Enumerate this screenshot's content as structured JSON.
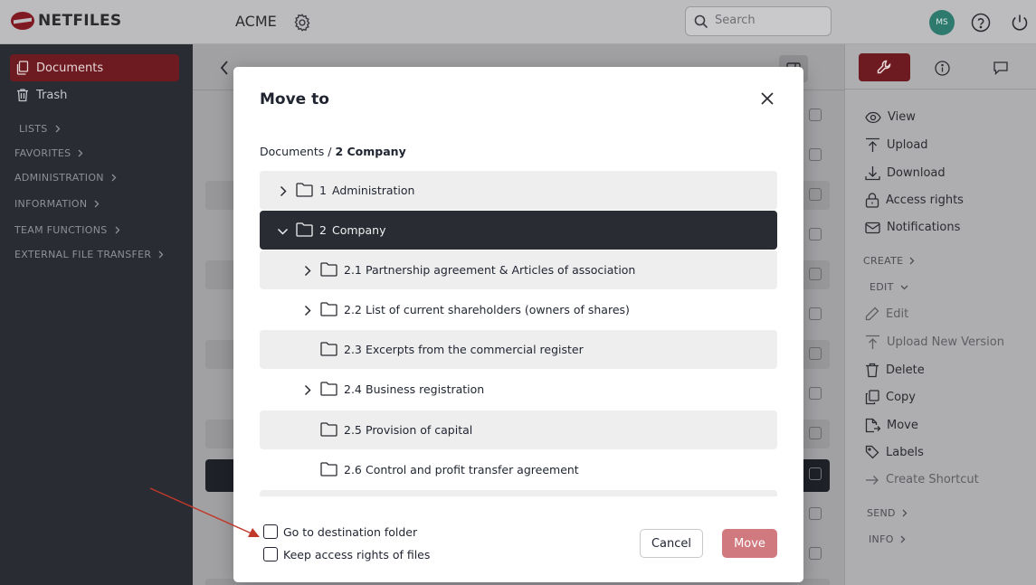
{
  "header": {
    "brand": "NETFILES",
    "workspace": "ACME",
    "search_placeholder": "Search",
    "avatar_initials": "MS"
  },
  "sidebar": {
    "items": [
      {
        "label": "Documents",
        "active": true
      },
      {
        "label": "Trash",
        "active": false
      }
    ],
    "sections": [
      "LISTS",
      "FAVORITES",
      "ADMINISTRATION",
      "INFORMATION",
      "TEAM FUNCTIONS",
      "EXTERNAL FILE TRANSFER"
    ]
  },
  "right_panel": {
    "actions": [
      {
        "label": "View",
        "icon": "eye-icon"
      },
      {
        "label": "Upload",
        "icon": "upload-icon"
      },
      {
        "label": "Download",
        "icon": "download-icon"
      },
      {
        "label": "Access rights",
        "icon": "lock-icon"
      },
      {
        "label": "Notifications",
        "icon": "envelope-icon"
      }
    ],
    "create_label": "CREATE",
    "edit_label": "EDIT",
    "edit_actions": [
      {
        "label": "Edit",
        "icon": "pencil-icon",
        "disabled": true
      },
      {
        "label": "Upload New Version",
        "icon": "upload-icon",
        "disabled": true
      },
      {
        "label": "Delete",
        "icon": "trash-icon",
        "disabled": false
      },
      {
        "label": "Copy",
        "icon": "copy-icon",
        "disabled": false
      },
      {
        "label": "Move",
        "icon": "move-file-icon",
        "disabled": false
      },
      {
        "label": "Labels",
        "icon": "tag-icon",
        "disabled": false
      },
      {
        "label": "Create Shortcut",
        "icon": "arrow-right-icon",
        "disabled": true
      }
    ],
    "send_label": "SEND",
    "info_label": "INFO"
  },
  "modal": {
    "title": "Move to",
    "breadcrumb_root": "Documents",
    "breadcrumb_sep": " / ",
    "breadcrumb_current": "2 Company",
    "folders": [
      {
        "num": "1",
        "name": "Administration",
        "level": 0,
        "expandable": true,
        "expanded": false,
        "selected": false
      },
      {
        "num": "2",
        "name": "Company",
        "level": 0,
        "expandable": true,
        "expanded": true,
        "selected": true
      },
      {
        "num": "2.1",
        "name": "Partnership agreement & Articles of association",
        "level": 1,
        "expandable": true,
        "expanded": false,
        "selected": false
      },
      {
        "num": "2.2",
        "name": "List of current shareholders (owners of shares)",
        "level": 1,
        "expandable": true,
        "expanded": false,
        "selected": false
      },
      {
        "num": "2.3",
        "name": "Excerpts from the commercial register",
        "level": 1,
        "expandable": false,
        "expanded": false,
        "selected": false
      },
      {
        "num": "2.4",
        "name": "Business registration",
        "level": 1,
        "expandable": true,
        "expanded": false,
        "selected": false
      },
      {
        "num": "2.5",
        "name": "Provision of capital",
        "level": 1,
        "expandable": false,
        "expanded": false,
        "selected": false
      },
      {
        "num": "2.6",
        "name": "Control and profit transfer agreement",
        "level": 1,
        "expandable": false,
        "expanded": false,
        "selected": false
      }
    ],
    "options": [
      {
        "label": "Go to destination folder",
        "checked": false
      },
      {
        "label": "Keep access rights of files",
        "checked": false
      }
    ],
    "cancel_label": "Cancel",
    "move_label": "Move"
  },
  "colors": {
    "brand_red": "#6d1a21",
    "move_button": "#d07a80",
    "annotation_arrow": "#c0392b"
  }
}
